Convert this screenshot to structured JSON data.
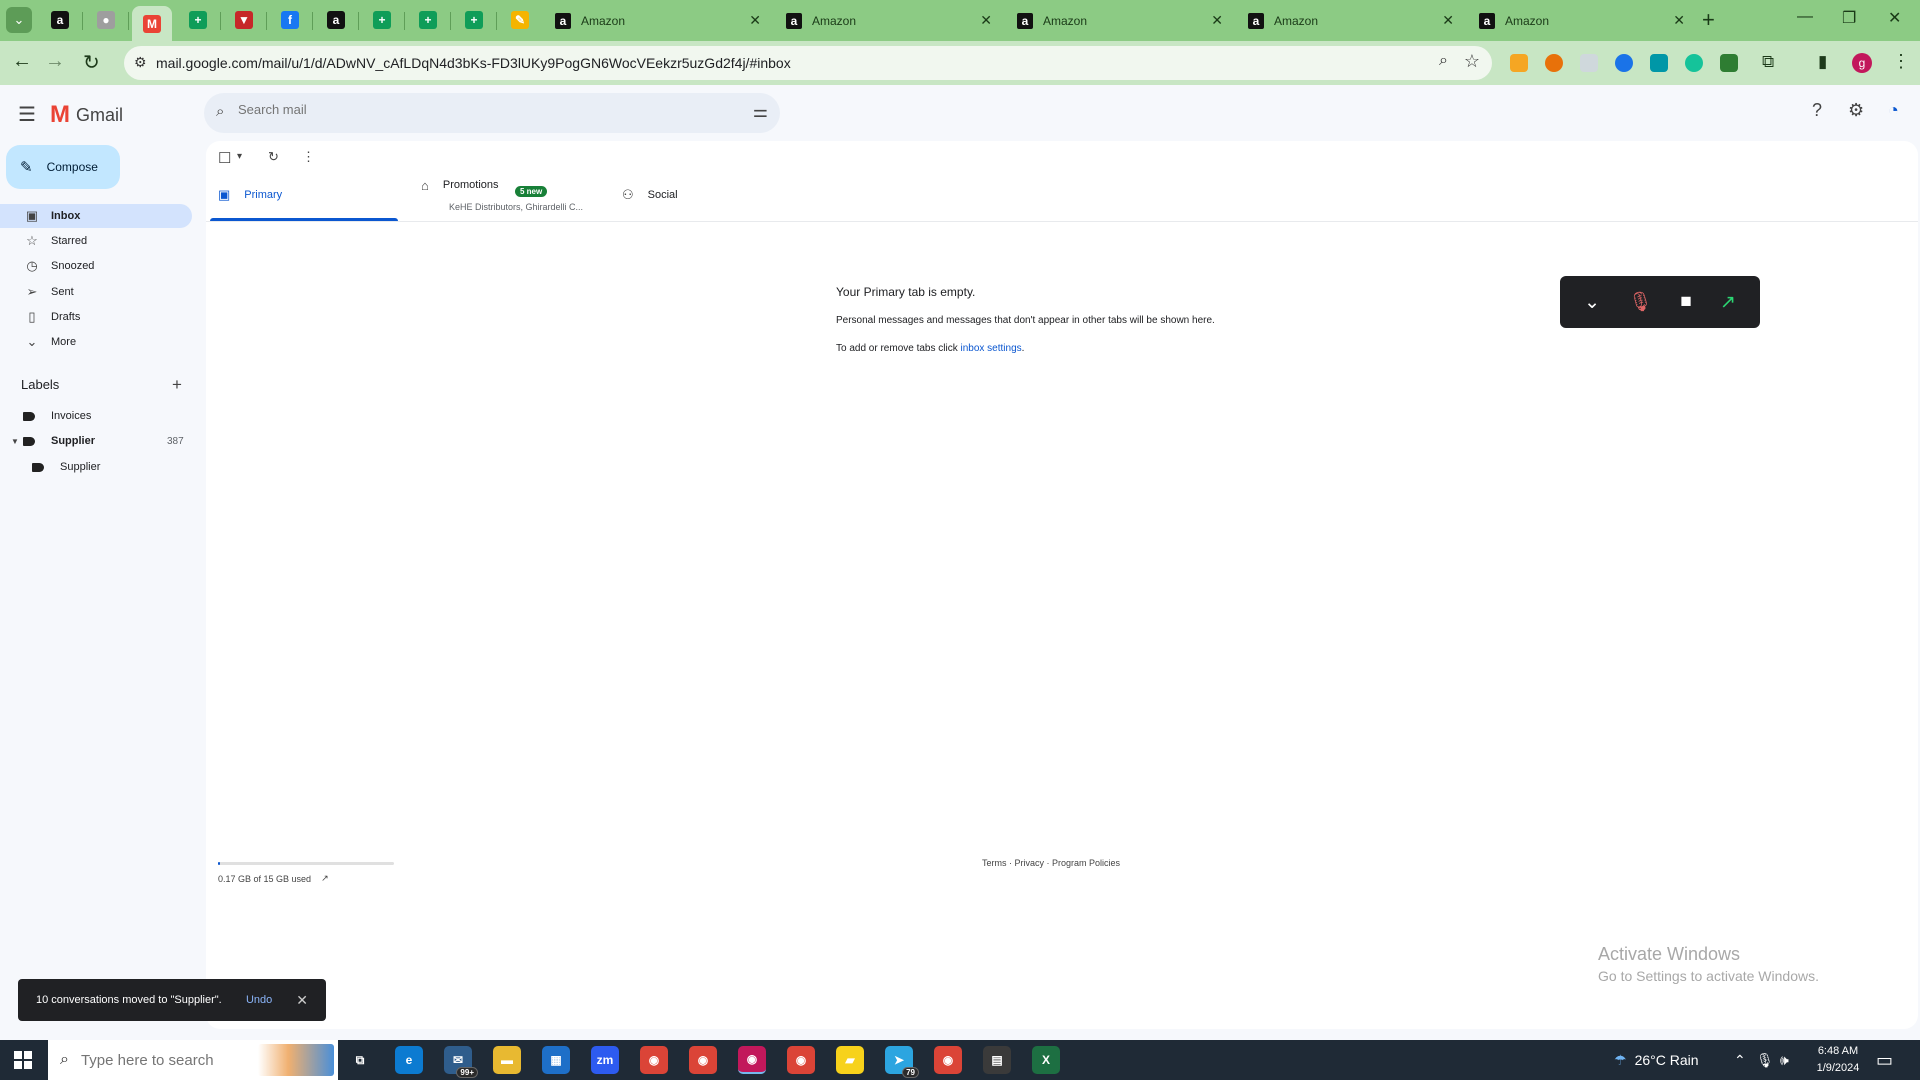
{
  "browser": {
    "tab_menu_glyph": "⌄",
    "pinned_tabs": [
      {
        "icon": "amazon-icon",
        "glyph": "a",
        "color": "#111111"
      },
      {
        "icon": "gray-circle-icon",
        "glyph": "●",
        "color": "#9e9e9e"
      },
      {
        "icon": "gmail-icon",
        "glyph": "M",
        "color": "#ea4335",
        "active": true
      },
      {
        "icon": "sheets-plus-icon",
        "glyph": "+",
        "color": "#0f9d58"
      },
      {
        "icon": "red-icon",
        "glyph": "▼",
        "color": "#c62828"
      },
      {
        "icon": "facebook-icon",
        "glyph": "f",
        "color": "#1877f2"
      },
      {
        "icon": "amazon-icon",
        "glyph": "a",
        "color": "#111111"
      },
      {
        "icon": "sheets-plus-icon",
        "glyph": "+",
        "color": "#0f9d58"
      },
      {
        "icon": "sheets-plus-icon",
        "glyph": "+",
        "color": "#0f9d58"
      },
      {
        "icon": "sheets-plus-icon",
        "glyph": "+",
        "color": "#0f9d58"
      },
      {
        "icon": "pencil-app-icon",
        "glyph": "✎",
        "color": "#f4b400"
      }
    ],
    "tabs": [
      {
        "title": "Amazon"
      },
      {
        "title": "Amazon"
      },
      {
        "title": "Amazon"
      },
      {
        "title": "Amazon"
      },
      {
        "title": "Amazon"
      }
    ],
    "tab_favicon_glyph": "a",
    "tab_close_glyph": "✕",
    "new_tab_glyph": "+",
    "window_controls": {
      "minimize": "—",
      "restore": "❐",
      "close": "✕"
    },
    "nav": {
      "back": "←",
      "forward": "→",
      "reload": "↻"
    },
    "url": "mail.google.com/mail/u/1/d/ADwNV_cAfLDqN4d3bKs-FD3lUKy9PogGN6WocVEekzr5uzGd2f4j/#inbox",
    "site_info_glyph": "⚙",
    "zoom_glyph": "⌕",
    "bookmark_glyph": "☆",
    "extensions": [
      {
        "icon": "extension-orange-icon",
        "color": "#f5a623"
      },
      {
        "icon": "extension-chrome-icon",
        "color": "#e8710a"
      },
      {
        "icon": "extension-gray-icon",
        "color": "#cfd8dc"
      },
      {
        "icon": "extension-blue-icon",
        "color": "#1a73e8"
      },
      {
        "icon": "extension-teal-icon",
        "color": "#0097a7"
      },
      {
        "icon": "extension-grammarly-icon",
        "color": "#15c39a"
      },
      {
        "icon": "extension-green-icon",
        "color": "#2e7d32"
      }
    ],
    "puzzle_glyph": "⧉",
    "sidepanel_glyph": "▮",
    "profile_initial": "g",
    "menu_glyph": "⋮"
  },
  "gmail": {
    "hamburger_glyph": "☰",
    "logo_letter": "M",
    "logo_text": "Gmail",
    "search_placeholder": "Search mail",
    "search_glyph": "⌕",
    "filter_glyph": "⚌",
    "help_glyph": "?",
    "settings_glyph": "⚙",
    "account_glyph": "◔",
    "compose_glyph": "✎",
    "compose_label": "Compose",
    "nav": [
      {
        "label": "Inbox",
        "glyph": "▣",
        "active": true
      },
      {
        "label": "Starred",
        "glyph": "☆"
      },
      {
        "label": "Snoozed",
        "glyph": "◷"
      },
      {
        "label": "Sent",
        "glyph": "➢"
      },
      {
        "label": "Drafts",
        "glyph": "▯"
      },
      {
        "label": "More",
        "glyph": "⌄"
      }
    ],
    "labels_title": "Labels",
    "labels_add_glyph": "+",
    "labels": [
      {
        "name": "Invoices",
        "count": ""
      },
      {
        "name": "Supplier",
        "count": "387",
        "bold": true,
        "expanded": true
      },
      {
        "name": "Supplier",
        "count": "",
        "nested": true
      }
    ],
    "caret_glyph": "▼",
    "toolbar": {
      "select_glyph": "☐",
      "select_caret": "▾",
      "refresh_glyph": "↻",
      "more_glyph": "⋮"
    },
    "categories": [
      {
        "label": "Primary",
        "glyph": "▣",
        "active": true
      },
      {
        "label": "Promotions",
        "glyph": "⌂",
        "badge": "5 new",
        "subtitle": "KeHE Distributors, Ghirardelli C..."
      },
      {
        "label": "Social",
        "glyph": "⚇"
      }
    ],
    "empty": {
      "title": "Your Primary tab is empty.",
      "line1": "Personal messages and messages that don't appear in other tabs will be shown here.",
      "line2_prefix": "To add or remove tabs click ",
      "line2_link": "inbox settings",
      "line2_suffix": "."
    },
    "storage": {
      "text": "0.17 GB of 15 GB used",
      "used_fraction": 0.011,
      "link_glyph": "↗"
    },
    "footer": {
      "terms": "Terms",
      "privacy": "Privacy",
      "policies": "Program Policies",
      "sep": " · "
    },
    "call_widget": {
      "collapse_glyph": "⌄",
      "mic_glyph": "🎙",
      "video_glyph": "■",
      "popout_glyph": "↗"
    },
    "snackbar": {
      "message": "10 conversations moved to \"Supplier\".",
      "undo": "Undo",
      "close": "✕"
    }
  },
  "watermark": {
    "line1": "Activate Windows",
    "line2": "Go to Settings to activate Windows."
  },
  "taskbar": {
    "search_placeholder": "Type here to search",
    "search_glyph": "⌕",
    "apps": [
      {
        "icon": "task-view-icon",
        "glyph": "⧉",
        "color": "#1f2a36"
      },
      {
        "icon": "edge-icon",
        "glyph": "e",
        "color": "#0c7bd1"
      },
      {
        "icon": "mail-icon",
        "glyph": "✉",
        "color": "#2f5d8c",
        "badge": "99+"
      },
      {
        "icon": "file-explorer-icon",
        "glyph": "▬",
        "color": "#e8b931"
      },
      {
        "icon": "store-icon",
        "glyph": "▦",
        "color": "#1e6fc8"
      },
      {
        "icon": "zoom-icon",
        "glyph": "zm",
        "color": "#2d5bf0"
      },
      {
        "icon": "chrome-icon",
        "glyph": "◉",
        "color": "#db4437"
      },
      {
        "icon": "chrome-icon",
        "glyph": "◉",
        "color": "#db4437"
      },
      {
        "icon": "chrome-icon",
        "glyph": "◉",
        "color": "#c2185b",
        "running": true
      },
      {
        "icon": "chrome-icon",
        "glyph": "◉",
        "color": "#db4437"
      },
      {
        "icon": "sticky-notes-icon",
        "glyph": "▰",
        "color": "#f7d21b"
      },
      {
        "icon": "telegram-icon",
        "glyph": "➤",
        "color": "#2ca5e0",
        "badge": "79"
      },
      {
        "icon": "chrome-icon",
        "glyph": "◉",
        "color": "#db4437"
      },
      {
        "icon": "calculator-icon",
        "glyph": "▤",
        "color": "#3a3a3a"
      },
      {
        "icon": "excel-icon",
        "glyph": "X",
        "color": "#1d6f42"
      }
    ],
    "weather": {
      "glyph": "☂",
      "text": "26°C  Rain"
    },
    "tray_glyphs": {
      "chevron": "⌃",
      "mic": "🎙",
      "volume": "🕪"
    },
    "time": "6:48 AM",
    "date": "1/9/2024",
    "notification_glyph": "▭"
  }
}
